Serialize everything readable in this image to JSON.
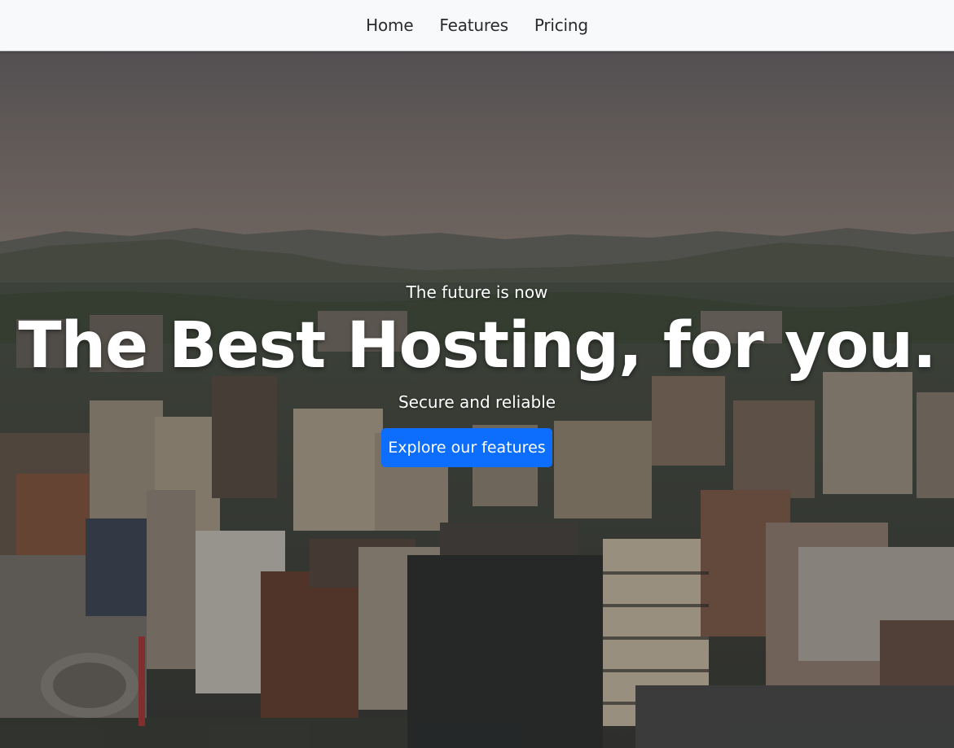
{
  "nav": {
    "items": [
      {
        "label": "Home"
      },
      {
        "label": "Features"
      },
      {
        "label": "Pricing"
      }
    ]
  },
  "hero": {
    "eyebrow": "The future is now",
    "headline": "The Best Hosting, for you.",
    "subline": "Secure and reliable",
    "cta_label": "Explore our features",
    "cta_color": "#0d6efd",
    "background": "aerial city skyline photo with river and hills"
  }
}
